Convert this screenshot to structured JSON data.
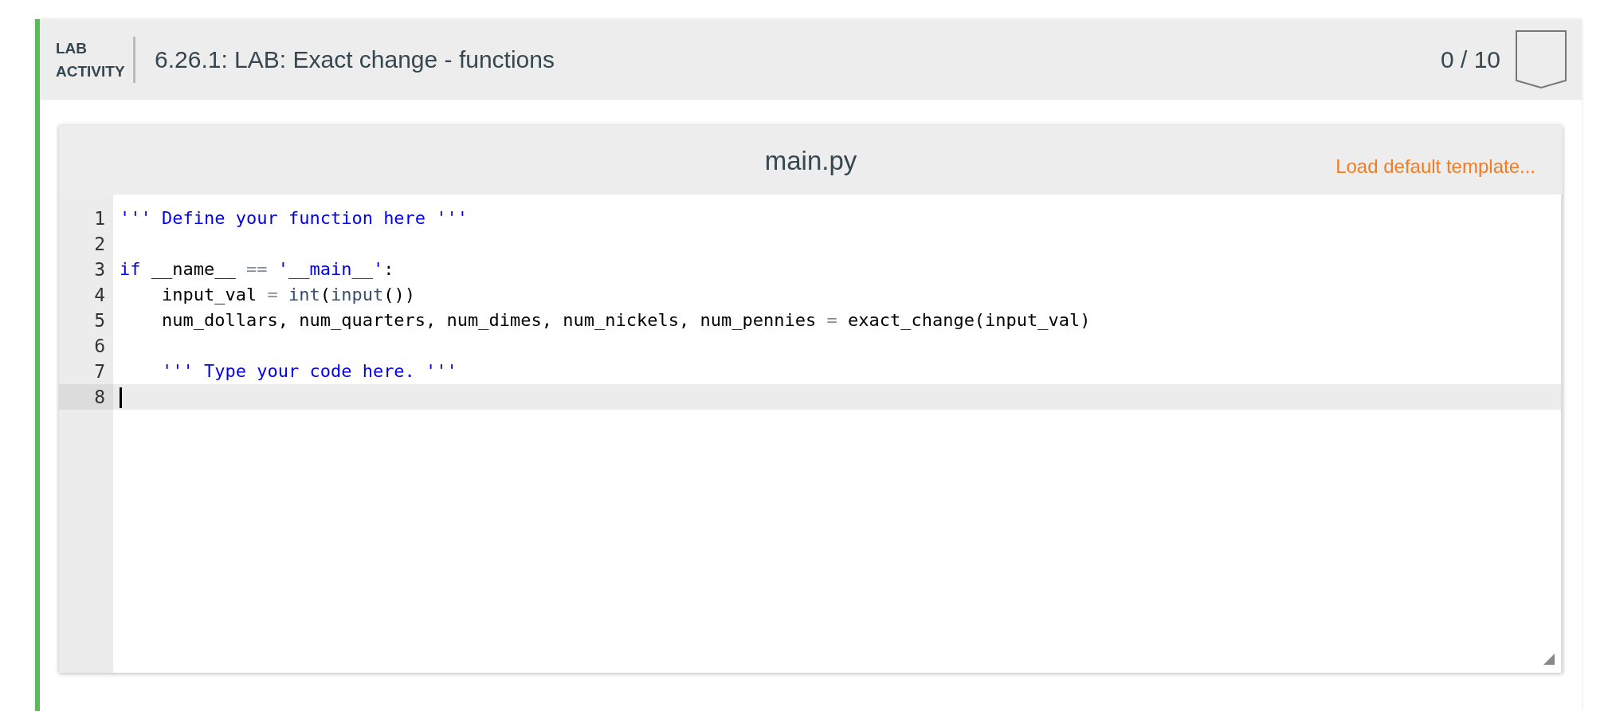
{
  "activity": {
    "label": "LAB ACTIVITY",
    "title": "6.26.1: LAB: Exact change - functions",
    "score": "0 / 10",
    "completed": false
  },
  "editor": {
    "filename": "main.py",
    "template_link": "Load default template...",
    "lines": [
      {
        "number": "1",
        "active": false,
        "tokens": [
          {
            "kind": "string",
            "text": "''' Define your function here '''"
          }
        ]
      },
      {
        "number": "2",
        "active": false
      },
      {
        "number": "3",
        "active": false,
        "tokens": [
          {
            "kind": "keyword",
            "text": "if"
          },
          {
            "kind": "plain",
            "text": " __name__ "
          },
          {
            "kind": "operator",
            "text": "== "
          },
          {
            "kind": "string",
            "text": "'__main__'"
          },
          {
            "kind": "plain",
            "text": ":"
          }
        ]
      },
      {
        "number": "4",
        "active": false,
        "tokens": [
          {
            "kind": "plain",
            "text": "    input_val "
          },
          {
            "kind": "operator",
            "text": "= "
          },
          {
            "kind": "builtin",
            "text": "int"
          },
          {
            "kind": "plain",
            "text": "("
          },
          {
            "kind": "builtin",
            "text": "input"
          },
          {
            "kind": "plain",
            "text": "())"
          }
        ]
      },
      {
        "number": "5",
        "active": false,
        "tokens": [
          {
            "kind": "plain",
            "text": "    num_dollars, num_quarters, num_dimes, num_nickels, num_pennies "
          },
          {
            "kind": "operator",
            "text": "="
          },
          {
            "kind": "plain",
            "text": " exact_change(input_val)"
          }
        ]
      },
      {
        "number": "6",
        "active": false
      },
      {
        "number": "7",
        "active": false,
        "tokens": [
          {
            "kind": "string",
            "text": "    ''' Type your code here. '''"
          }
        ]
      },
      {
        "number": "8",
        "active": true
      }
    ]
  }
}
